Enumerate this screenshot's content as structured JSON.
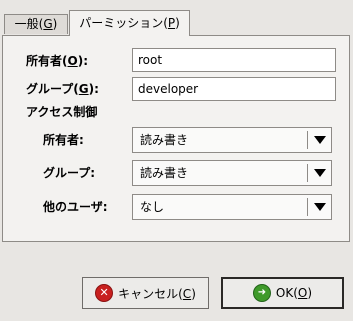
{
  "tabs": {
    "general": {
      "label": "一般(",
      "mnemonic": "G",
      "suffix": ")"
    },
    "permissions": {
      "label": "パーミッション(",
      "mnemonic": "P",
      "suffix": ")"
    }
  },
  "owner": {
    "label_pre": "所有者(",
    "mnemonic": "O",
    "label_post": "):",
    "value": "root"
  },
  "group": {
    "label_pre": "グループ(",
    "mnemonic": "G",
    "label_post": "):",
    "value": "developer"
  },
  "access": {
    "heading": "アクセス制御",
    "owner": {
      "label": "所有者:",
      "value": "読み書き"
    },
    "group": {
      "label": "グループ:",
      "value": "読み書き"
    },
    "others": {
      "label": "他のユーザ:",
      "value": "なし"
    }
  },
  "buttons": {
    "cancel": {
      "label_pre": "キャンセル(",
      "mnemonic": "C",
      "label_post": ")",
      "icon": "cancel-icon"
    },
    "ok": {
      "label_pre": "OK(",
      "mnemonic": "O",
      "label_post": ")",
      "icon": "ok-icon"
    }
  },
  "colors": {
    "cancel_icon": "#c8201f",
    "ok_icon": "#3f9a2a"
  }
}
